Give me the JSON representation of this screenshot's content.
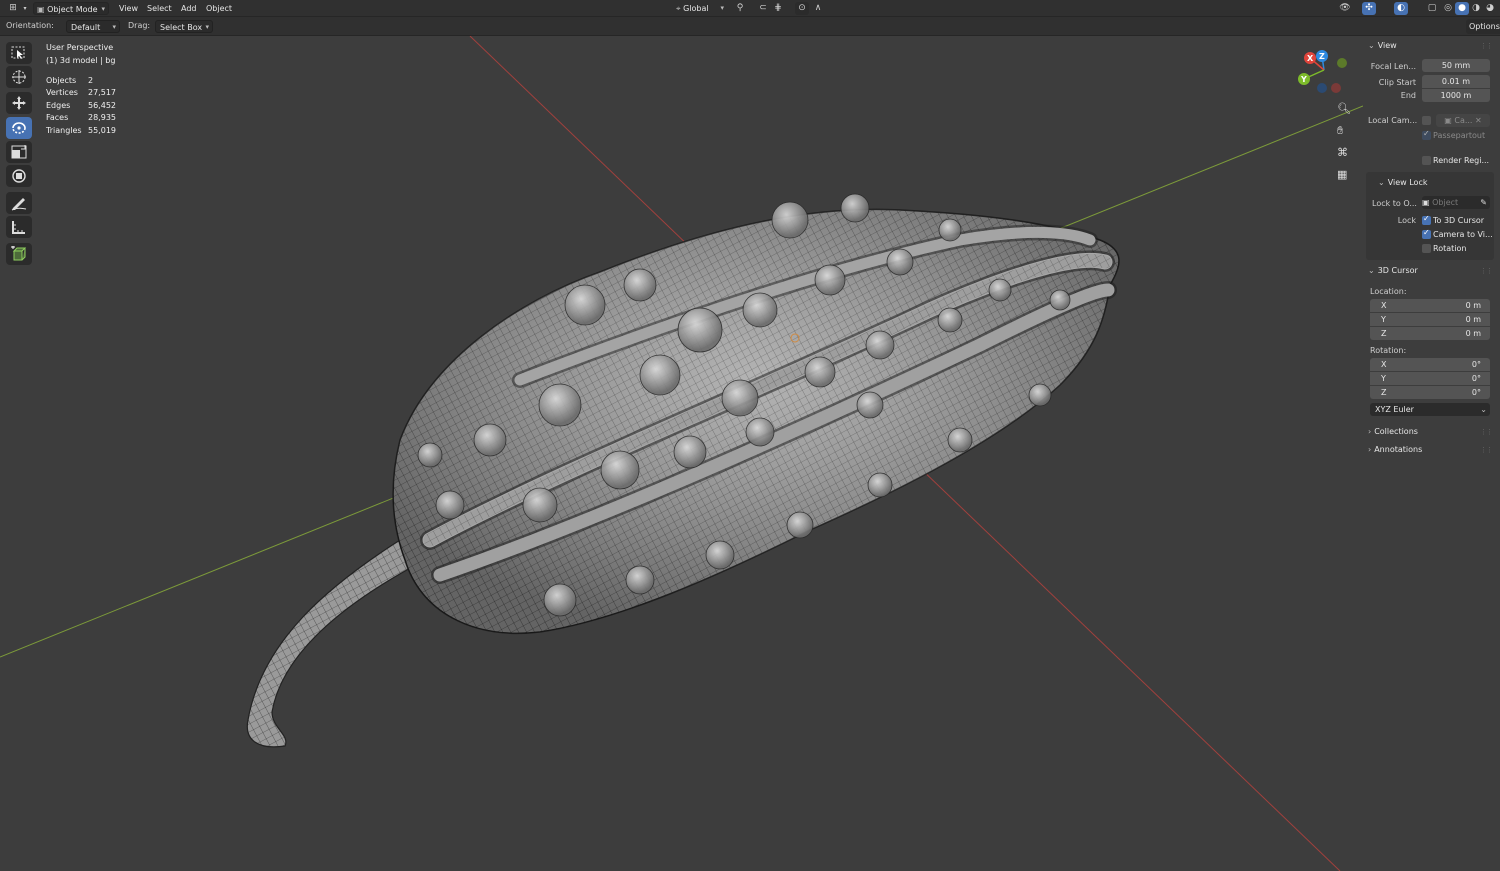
{
  "header": {
    "mode_label": "Object Mode",
    "menus": [
      "View",
      "Select",
      "Add",
      "Object"
    ],
    "transform_orientation": "Global",
    "icons": [
      "editor-type-icon",
      "mode-icon",
      "pivot-icon",
      "snap-icon",
      "proportional-icon",
      "visibility-icon",
      "gizmo-icon",
      "overlay-icon",
      "xray-icon",
      "shading-wireframe-icon",
      "shading-solid-icon",
      "shading-material-icon",
      "shading-rendered-icon"
    ]
  },
  "toolsettings": {
    "orientation_label": "Orientation:",
    "orientation_value": "Default",
    "drag_label": "Drag:",
    "drag_value": "Select Box",
    "options_label": "Options"
  },
  "toolbar": {
    "tools": [
      "select-box-icon",
      "cursor-icon",
      "move-icon",
      "rotate-icon",
      "scale-icon",
      "transform-icon",
      "annotate-icon",
      "measure-icon",
      "add-cube-icon"
    ],
    "active_tool": "rotate-icon"
  },
  "viewport": {
    "perspective": "User Perspective",
    "object_info": "(1) 3d model | bg",
    "stats": [
      {
        "label": "Objects",
        "value": "2"
      },
      {
        "label": "Vertices",
        "value": "27,517"
      },
      {
        "label": "Edges",
        "value": "56,452"
      },
      {
        "label": "Faces",
        "value": "28,935"
      },
      {
        "label": "Triangles",
        "value": "55,019"
      }
    ],
    "gizmo_axes": {
      "x": "X",
      "y": "Y",
      "z": "Z"
    },
    "axis_colors": {
      "x": "#e0443b",
      "y": "#7dbb2a",
      "z": "#2f8ae0"
    },
    "nav_icons": [
      "zoom-icon",
      "pan-hand-icon",
      "camera-icon",
      "ortho-grid-icon"
    ]
  },
  "sidebar": {
    "view": {
      "title": "View",
      "focal_label": "Focal Len...",
      "focal_value": "50 mm",
      "clip_start_label": "Clip Start",
      "clip_start_value": "0.01 m",
      "clip_end_label": "End",
      "clip_end_value": "1000 m",
      "local_camera_label": "Local Cam...",
      "local_camera_value": "Ca...",
      "passepartout_label": "Passepartout",
      "render_region_label": "Render Regi..."
    },
    "view_lock": {
      "title": "View Lock",
      "lock_to_object_label": "Lock to O...",
      "lock_to_object_placeholder": "Object",
      "lock_label": "Lock",
      "to_3d_cursor_label": "To 3D Cursor",
      "camera_to_view_label": "Camera to Vi...",
      "rotation_label": "Rotation",
      "to_3d_cursor_checked": true,
      "camera_to_view_checked": true,
      "rotation_checked": false
    },
    "cursor": {
      "title": "3D Cursor",
      "location_label": "Location:",
      "location": [
        {
          "axis": "X",
          "value": "0 m"
        },
        {
          "axis": "Y",
          "value": "0 m"
        },
        {
          "axis": "Z",
          "value": "0 m"
        }
      ],
      "rotation_label": "Rotation:",
      "rotation": [
        {
          "axis": "X",
          "value": "0°"
        },
        {
          "axis": "Y",
          "value": "0°"
        },
        {
          "axis": "Z",
          "value": "0°"
        }
      ],
      "rotation_mode": "XYZ Euler"
    },
    "collections_title": "Collections",
    "annotations_title": "Annotations"
  }
}
